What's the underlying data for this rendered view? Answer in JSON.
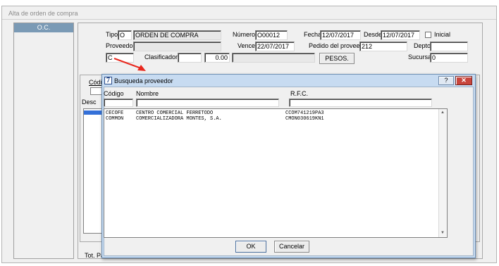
{
  "window": {
    "title": "Alta de orden de compra"
  },
  "sidebar": {
    "tab_label": "O.C."
  },
  "form": {
    "tipo_label": "Tipo",
    "tipo_value": "O",
    "tipo_desc": "ORDEN DE COMPRA",
    "numero_label": "Número",
    "numero_value": "O00012",
    "fecha_label": "Fecha",
    "fecha_value": "12/07/2017",
    "desde_label": "Desde",
    "desde_value": "12/07/2017",
    "inicial_label": "Inicial",
    "proveedor_label": "Proveedor:",
    "proveedor_value": "",
    "vence_label": "Vence",
    "vence_value": "22/07/2017",
    "pedido_label": "Pedido del proveedor",
    "pedido_value": "212",
    "depto_label": "Depto",
    "depto_value": "",
    "c_value": "C",
    "clasificador_label": "Clasificador",
    "clasificador_value": "",
    "amount_value": "0.00",
    "currency_button": "PESOS.",
    "sucursal_label": "Sucursal",
    "sucursal_value": "0"
  },
  "lower_panel": {
    "codigo_partial": "Códi",
    "desc_partial": "Desc",
    "tot_partial": "Tot. Pa"
  },
  "dialog": {
    "title": "Busqueda proveedor",
    "help_button": "?",
    "close_button": "✕",
    "col_codigo": "Código",
    "col_nombre": "Nombre",
    "col_rfc": "R.F.C.",
    "rows": [
      {
        "codigo": "CECOFE",
        "nombre": "CENTRO COMERCIAL FERRETODO",
        "rfc": "CCOM741219PA3"
      },
      {
        "codigo": "COMMON",
        "nombre": "COMERCIALIZADORA MONTES, S.A.",
        "rfc": "CMON030619KN1"
      }
    ],
    "ok_button": "OK",
    "cancel_button": "Cancelar"
  },
  "colors": {
    "annotation_arrow": "#e8281e",
    "titlebar_blue": "#c9ddf2",
    "sidebar_header": "#7a9ab5"
  }
}
